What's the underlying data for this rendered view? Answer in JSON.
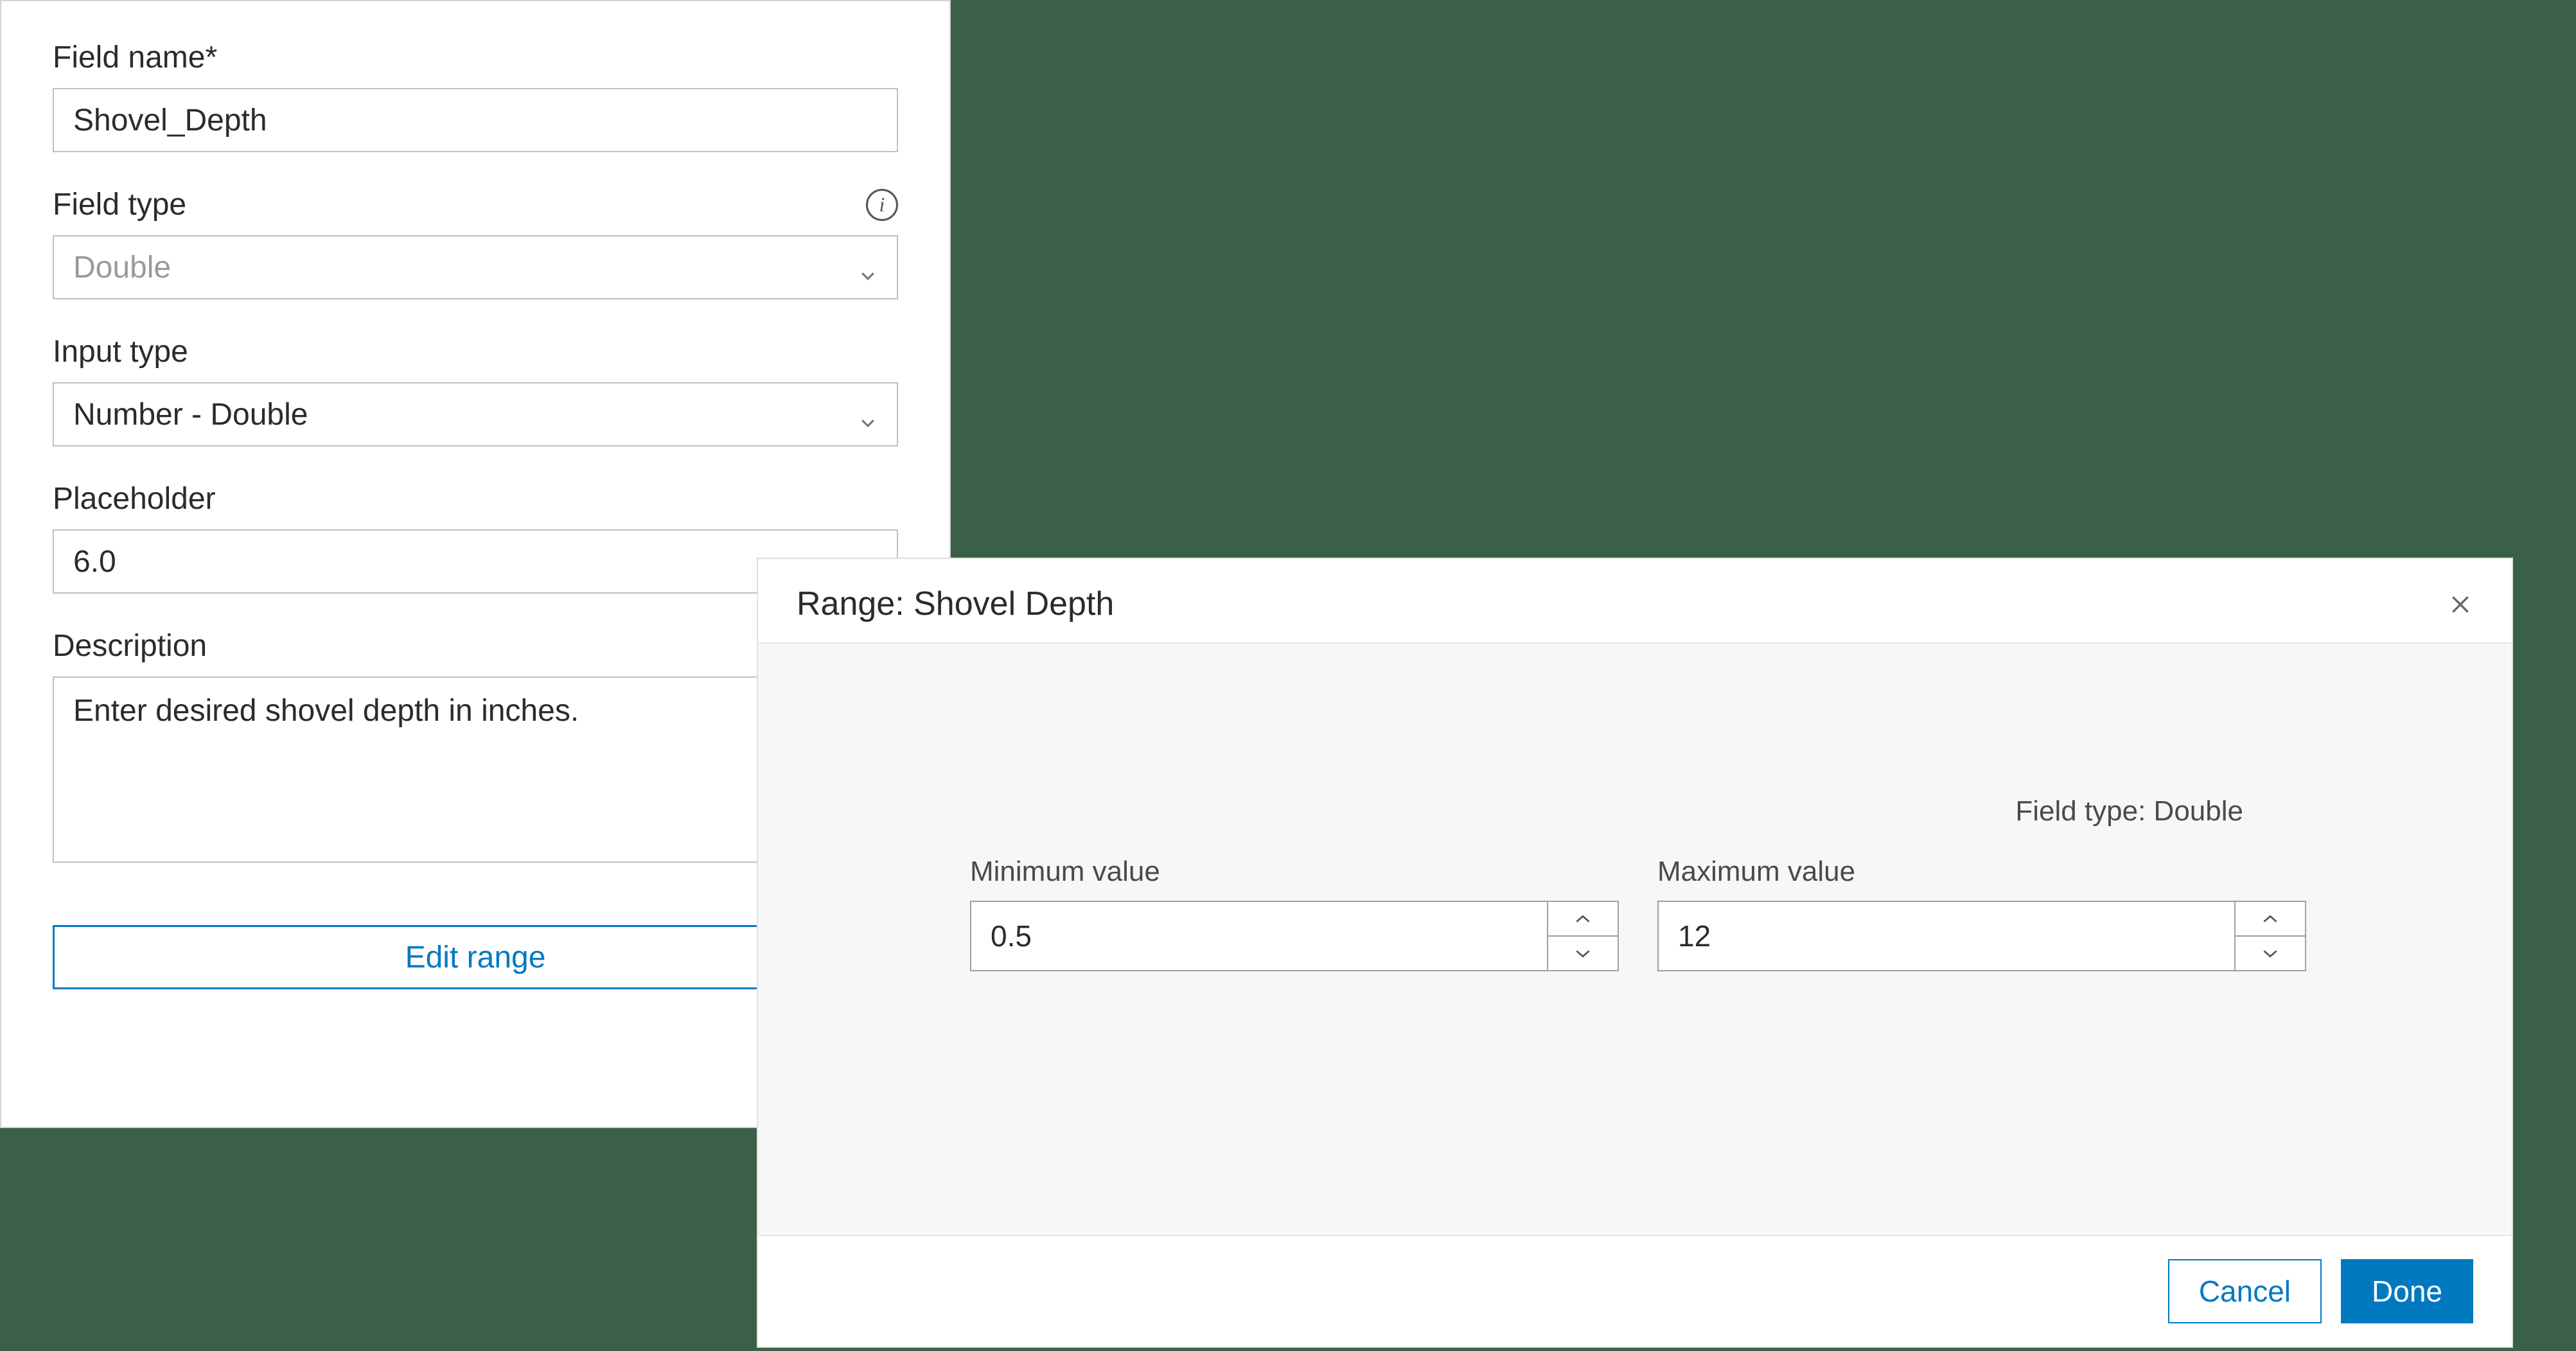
{
  "left_panel": {
    "field_name": {
      "label": "Field name*",
      "value": "Shovel_Depth"
    },
    "field_type": {
      "label": "Field type",
      "value": "Double"
    },
    "input_type": {
      "label": "Input type",
      "value": "Number - Double"
    },
    "placeholder": {
      "label": "Placeholder",
      "value": "6.0"
    },
    "description": {
      "label": "Description",
      "value": "Enter desired shovel depth in inches."
    },
    "edit_range_label": "Edit range"
  },
  "dialog": {
    "title": "Range: Shovel Depth",
    "field_type_text": "Field type: Double",
    "minimum": {
      "label": "Minimum value",
      "value": "0.5"
    },
    "maximum": {
      "label": "Maximum value",
      "value": "12"
    },
    "cancel_label": "Cancel",
    "done_label": "Done"
  }
}
